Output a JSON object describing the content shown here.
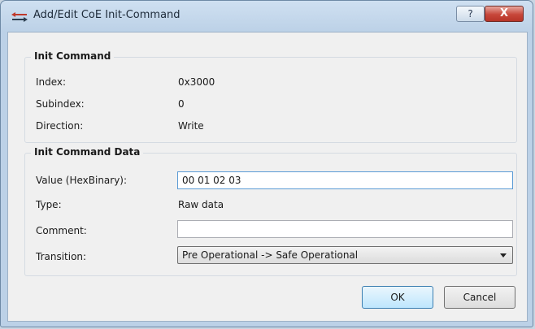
{
  "window": {
    "title": "Add/Edit CoE Init-Command",
    "help_label": "?",
    "close_label": "X"
  },
  "init_command": {
    "title": "Init Command",
    "index_label": "Index:",
    "index_value": "0x3000",
    "subindex_label": "Subindex:",
    "subindex_value": "0",
    "direction_label": "Direction:",
    "direction_value": "Write"
  },
  "init_command_data": {
    "title": "Init Command Data",
    "value_label": "Value (HexBinary):",
    "value_input": "00 01 02 03",
    "type_label": "Type:",
    "type_value": "Raw data",
    "comment_label": "Comment:",
    "comment_input": "",
    "transition_label": "Transition:",
    "transition_selected": "Pre Operational -> Safe Operational"
  },
  "buttons": {
    "ok": "OK",
    "cancel": "Cancel"
  }
}
